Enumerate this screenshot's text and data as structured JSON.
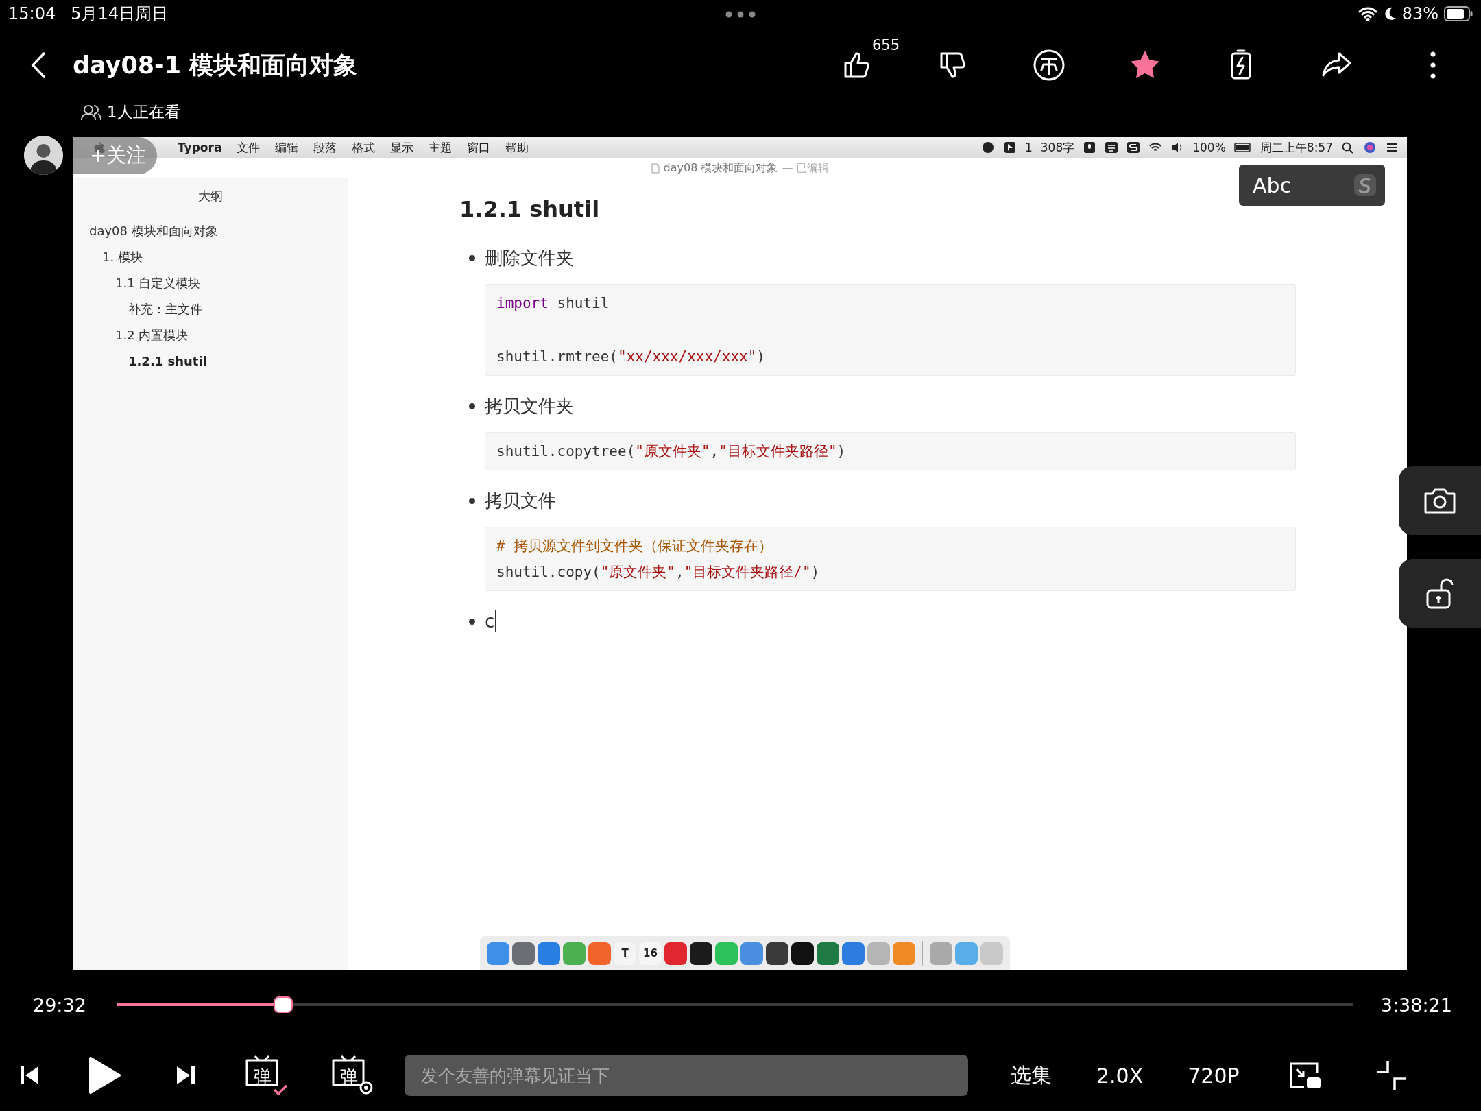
{
  "status_bar": {
    "time": "15:04",
    "date": "5月14日周日",
    "battery": "83%"
  },
  "header": {
    "title": "day08-1 模块和面向对象",
    "viewers": "1人正在看",
    "actions": [
      {
        "kind": "like",
        "count": "655",
        "selected": false
      },
      {
        "kind": "dislike",
        "selected": false
      },
      {
        "kind": "coin",
        "selected": false
      },
      {
        "kind": "favorite",
        "selected": true
      },
      {
        "kind": "charge",
        "selected": false
      },
      {
        "kind": "share",
        "selected": false
      },
      {
        "kind": "more",
        "selected": false
      }
    ]
  },
  "uploader": {
    "follow_label": "+关注"
  },
  "video": {
    "menubar": {
      "app": "Typora",
      "menus": [
        "文件",
        "编辑",
        "段落",
        "格式",
        "显示",
        "主题",
        "窗口",
        "帮助"
      ],
      "status_number": "1",
      "word_count": "308字",
      "battery": "100%",
      "clock": "周二上午8:57"
    },
    "window_title": "day08 模块和面向对象",
    "window_status": "— 已编辑",
    "input_indicator": "Abc",
    "outline": {
      "title": "大纲",
      "items": [
        {
          "label": "day08 模块和面向对象",
          "selected": false,
          "children": [
            {
              "label": "1. 模块",
              "selected": false,
              "children": [
                {
                  "label": "1.1 自定义模块",
                  "selected": false,
                  "children": [
                    {
                      "label": "补充：主文件",
                      "selected": false
                    }
                  ]
                },
                {
                  "label": "1.2 内置模块",
                  "selected": false,
                  "children": [
                    {
                      "label": "1.2.1 shutil",
                      "selected": true
                    }
                  ]
                }
              ]
            }
          ]
        }
      ]
    },
    "document": {
      "heading": "1.2.1 shutil",
      "items": [
        {
          "text": "删除文件夹",
          "editing": false,
          "code": [
            {
              "blank_before": false,
              "tokens": [
                {
                  "kind": "keyword",
                  "text": "import"
                },
                {
                  "kind": "plain",
                  "text": " shutil"
                }
              ]
            },
            {
              "blank_before": true,
              "tokens": [
                {
                  "kind": "plain",
                  "text": "shutil.rmtree("
                },
                {
                  "kind": "string",
                  "text": "\"xx/xxx/xxx/xxx\""
                },
                {
                  "kind": "plain",
                  "text": ")"
                }
              ]
            }
          ]
        },
        {
          "text": "拷贝文件夹",
          "editing": false,
          "code": [
            {
              "blank_before": false,
              "tokens": [
                {
                  "kind": "plain",
                  "text": "shutil.copytree("
                },
                {
                  "kind": "string",
                  "text": "\"原文件夹\""
                },
                {
                  "kind": "plain",
                  "text": ","
                },
                {
                  "kind": "string",
                  "text": "\"目标文件夹路径\""
                },
                {
                  "kind": "plain",
                  "text": ")"
                }
              ]
            }
          ]
        },
        {
          "text": "拷贝文件",
          "editing": false,
          "code": [
            {
              "blank_before": false,
              "tokens": [
                {
                  "kind": "comment",
                  "text": "# 拷贝源文件到文件夹（保证文件夹存在）"
                }
              ]
            },
            {
              "blank_before": false,
              "tokens": [
                {
                  "kind": "plain",
                  "text": "shutil.copy("
                },
                {
                  "kind": "string",
                  "text": "\"原文件夹\""
                },
                {
                  "kind": "plain",
                  "text": ","
                },
                {
                  "kind": "string",
                  "text": "\"目标文件夹路径/\""
                },
                {
                  "kind": "plain",
                  "text": ")"
                }
              ]
            }
          ]
        },
        {
          "text": "c",
          "editing": true
        }
      ]
    },
    "dock": {
      "apps": [
        {
          "color": "#3d8fe8"
        },
        {
          "color": "#6b6f75"
        },
        {
          "color": "#2a7de1"
        },
        {
          "color": "#4caf50"
        },
        {
          "color": "#f2642a"
        },
        {
          "color": "#f4f4f4",
          "label": "T"
        },
        {
          "color": "#f6f6f6",
          "label": "16"
        },
        {
          "color": "#e0262e"
        },
        {
          "color": "#1c1c1c"
        },
        {
          "color": "#2dc15a"
        },
        {
          "color": "#4a8fe0"
        },
        {
          "color": "#3a3a3a"
        },
        {
          "color": "#111111"
        },
        {
          "color": "#1f7a44"
        },
        {
          "color": "#2d7de0"
        },
        {
          "color": "#b5b5b5"
        },
        {
          "color": "#f08a24"
        },
        {
          "color": "#a9a9a9"
        },
        {
          "color": "#5aaee8"
        },
        {
          "color": "#c9c9c9"
        }
      ]
    }
  },
  "playback": {
    "elapsed": "29:32",
    "duration": "3:38:21",
    "level": 0.135
  },
  "controls": {
    "danmaku_glyph": "弹",
    "danmaku_on": true,
    "settings_glyph": "弹",
    "danmaku_placeholder": "发个友善的弹幕见证当下",
    "episodes": "选集",
    "speed": "2.0X",
    "quality": "720P"
  }
}
